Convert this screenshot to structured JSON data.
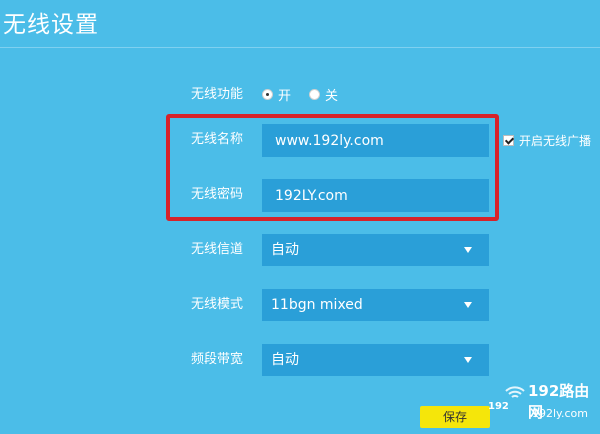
{
  "page": {
    "title": "无线设置"
  },
  "wireless_function": {
    "label": "无线功能",
    "options": [
      "开",
      "关"
    ],
    "selected": "开"
  },
  "wireless_name": {
    "label": "无线名称",
    "value": "www.192ly.com"
  },
  "broadcast": {
    "label": "开启无线广播",
    "checked": true
  },
  "wireless_password": {
    "label": "无线密码",
    "value": "192LY.com"
  },
  "wireless_channel": {
    "label": "无线信道",
    "selected": "自动"
  },
  "wireless_mode": {
    "label": "无线模式",
    "selected": "11bgn mixed"
  },
  "bandwidth": {
    "label": "频段带宽",
    "selected": "自动"
  },
  "actions": {
    "save_label": "保存"
  },
  "watermark": {
    "brand": "192路由网",
    "url": "192ly.com",
    "number": "192"
  },
  "colors": {
    "background": "#4bbde8",
    "field": "#2a9fd8",
    "highlight": "#d6232a",
    "save_button": "#f5e60a"
  }
}
